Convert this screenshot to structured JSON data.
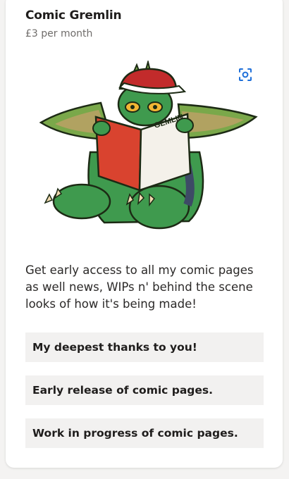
{
  "tier": {
    "title": "Comic Gremlin",
    "price": "£3 per month",
    "description": "Get early access to all my comic pages as well news, WIPs n' behind the scene looks of how it's being made!",
    "image_icon": "scan-icon",
    "comic_cover_text": "GEMLIN",
    "accent_color": "#1e6fd9"
  },
  "benefits": [
    "My deepest thanks to you!",
    "Early release of comic pages.",
    "Work in progress of comic pages."
  ]
}
